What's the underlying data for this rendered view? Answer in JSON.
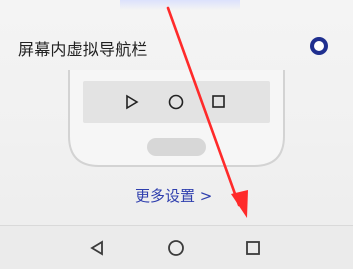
{
  "setting_option": {
    "label": "屏幕内虚拟导航栏",
    "selected": true
  },
  "more_settings": {
    "label": "更多设置 >"
  },
  "illustration": {
    "navigation_icons": [
      "back-triangle-icon",
      "home-circle-icon",
      "recent-square-icon"
    ]
  },
  "system_nav": {
    "buttons": [
      "back-triangle-icon",
      "home-circle-icon",
      "recent-square-icon"
    ]
  },
  "colors": {
    "accent": "#1f2f8f",
    "link": "#2f3fae",
    "annotation_arrow": "#ff2a2a"
  }
}
